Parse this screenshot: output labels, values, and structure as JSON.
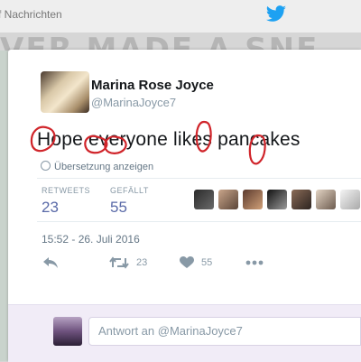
{
  "topbar": {
    "notifications_label": "f Nachrichten",
    "bird_icon": "twitter-bird-icon"
  },
  "background": {
    "headline_text": "VER MADE A SNE"
  },
  "tweet": {
    "author_name": "Marina Rose Joyce",
    "author_handle": "@MarinaJoyce7",
    "text": "Hope everyone likes pancakes",
    "translate_label": "Übersetzung anzeigen",
    "stats": [
      {
        "label": "RETWEETS",
        "value": "23"
      },
      {
        "label": "GEFÄLLT",
        "value": "55"
      }
    ],
    "timestamp": "15:52 - 26. Juli 2016",
    "actions": {
      "retweet_count": "23",
      "like_count": "55"
    },
    "annotation_color": "#d0242a"
  },
  "reply": {
    "placeholder": "Antwort an @MarinaJoyce7"
  },
  "colors": {
    "stat_value": "#5a6aa8",
    "secondary_text": "#8899a6",
    "twitter_blue": "#1da1f2"
  }
}
